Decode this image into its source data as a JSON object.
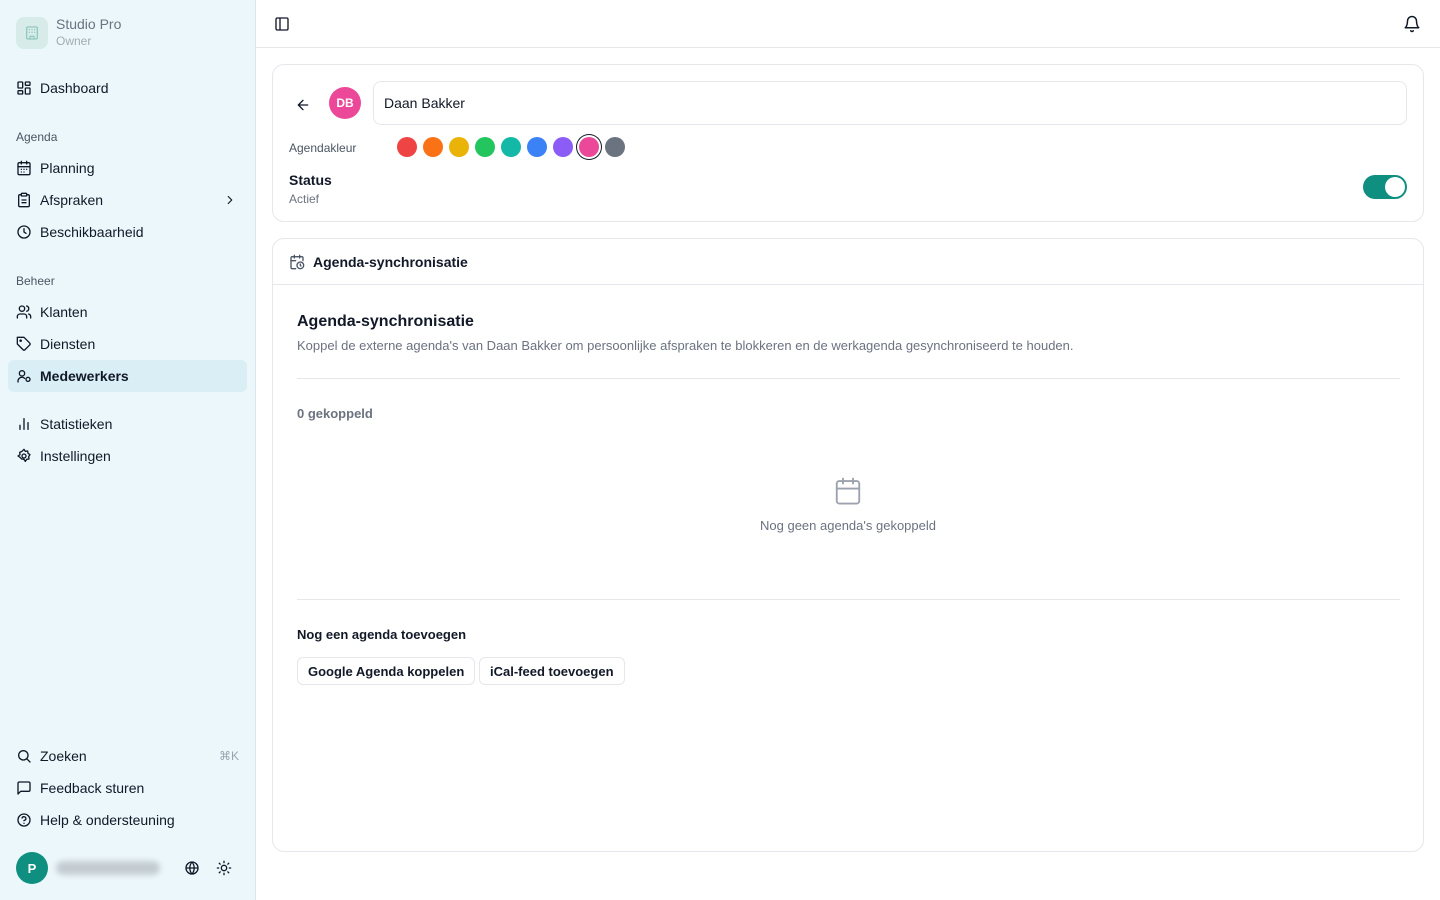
{
  "brand": {
    "name": "Studio Pro",
    "role": "Owner"
  },
  "sidebar": {
    "dashboard": "Dashboard",
    "section_agenda": "Agenda",
    "planning": "Planning",
    "afspraken": "Afspraken",
    "beschikbaarheid": "Beschikbaarheid",
    "section_beheer": "Beheer",
    "klanten": "Klanten",
    "diensten": "Diensten",
    "medewerkers": "Medewerkers",
    "statistieken": "Statistieken",
    "instellingen": "Instellingen",
    "zoeken": "Zoeken",
    "zoeken_shortcut": "⌘K",
    "feedback": "Feedback sturen",
    "help": "Help & ondersteuning"
  },
  "user": {
    "initial": "P"
  },
  "profile": {
    "initials": "DB",
    "name_value": "Daan Bakker",
    "color_label": "Agendakleur",
    "colors": [
      "#ef4444",
      "#f97316",
      "#eab308",
      "#22c55e",
      "#14b8a6",
      "#3b82f6",
      "#8b5cf6",
      "#ec4899",
      "#6b7280"
    ],
    "selected_color": "#ec4899",
    "status_label": "Status",
    "status_value": "Actief",
    "status_on": true
  },
  "sync": {
    "header_title": "Agenda-synchronisatie",
    "title": "Agenda-synchronisatie",
    "description": "Koppel de externe agenda's van Daan Bakker om persoonlijke afspraken te blokkeren en de werkagenda gesynchroniseerd te houden.",
    "count": "0 gekoppeld",
    "empty_text": "Nog geen agenda's gekoppeld",
    "add_title": "Nog een agenda toevoegen",
    "google_button": "Google Agenda koppelen",
    "ical_button": "iCal-feed toevoegen"
  },
  "colors": {
    "accent": "#0f8f80",
    "sidebar_bg": "#ecf7fb",
    "active_item_bg": "#d9eef5",
    "avatar_pink": "#ec4899"
  }
}
